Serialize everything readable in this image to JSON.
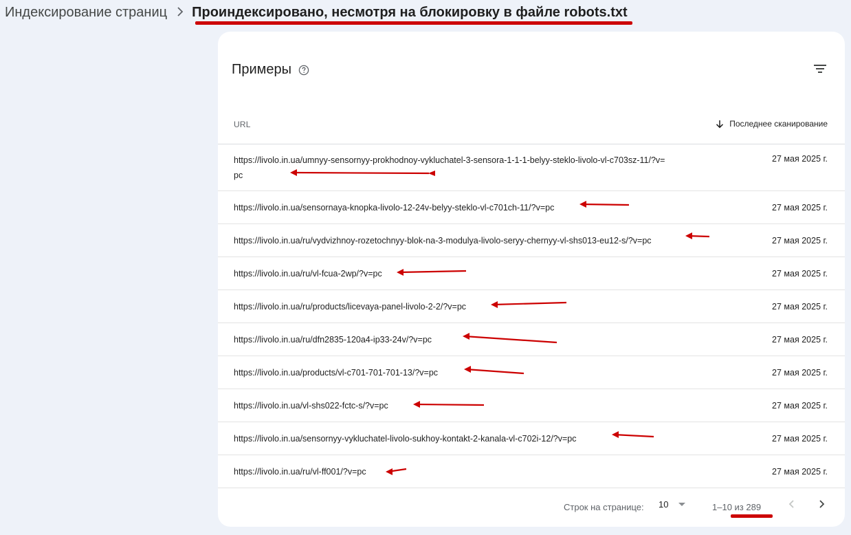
{
  "breadcrumb": {
    "parent": "Индексирование страниц",
    "separator": "›",
    "current": "Проиндексировано, несмотря на блокировку в файле robots.txt"
  },
  "card": {
    "title": "Примеры",
    "help_icon": "help-circle-icon",
    "filter_icon": "filter-icon"
  },
  "table": {
    "columns": {
      "url": "URL",
      "last_crawl": "Последнее сканирование",
      "sort_icon": "arrow-down-icon"
    },
    "rows": [
      {
        "url": "https://livolo.in.ua/umnyy-sensornyy-prokhodnoy-vykluchatel-3-sensora-1-1-1-belyy-steklo-livolo-vl-c703sz-11/?v=pc",
        "date": "27 мая 2025 г."
      },
      {
        "url": "https://livolo.in.ua/sensornaya-knopka-livolo-12-24v-belyy-steklo-vl-c701ch-11/?v=pc",
        "date": "27 мая 2025 г."
      },
      {
        "url": "https://livolo.in.ua/ru/vydvizhnoy-rozetochnyy-blok-na-3-modulya-livolo-seryy-chernyy-vl-shs013-eu12-s/?v=pc",
        "date": "27 мая 2025 г."
      },
      {
        "url": "https://livolo.in.ua/ru/vl-fcua-2wp/?v=pc",
        "date": "27 мая 2025 г."
      },
      {
        "url": "https://livolo.in.ua/ru/products/licevaya-panel-livolo-2-2/?v=pc",
        "date": "27 мая 2025 г."
      },
      {
        "url": "https://livolo.in.ua/ru/dfn2835-120a4-ip33-24v/?v=pc",
        "date": "27 мая 2025 г."
      },
      {
        "url": "https://livolo.in.ua/products/vl-c701-701-701-13/?v=pc",
        "date": "27 мая 2025 г."
      },
      {
        "url": "https://livolo.in.ua/vl-shs022-fctc-s/?v=pc",
        "date": "27 мая 2025 г."
      },
      {
        "url": "https://livolo.in.ua/sensornyy-vykluchatel-livolo-sukhoy-kontakt-2-kanala-vl-c702i-12/?v=pc",
        "date": "27 мая 2025 г."
      },
      {
        "url": "https://livolo.in.ua/ru/vl-ff001/?v=pc",
        "date": "27 мая 2025 г."
      }
    ]
  },
  "pagination": {
    "rows_per_page_label": "Строк на странице:",
    "rows_per_page_value": "10",
    "range": "1–10 из 289",
    "prev_icon": "chevron-left-icon",
    "next_icon": "chevron-right-icon"
  },
  "annotations": {
    "color": "#cc0000"
  }
}
